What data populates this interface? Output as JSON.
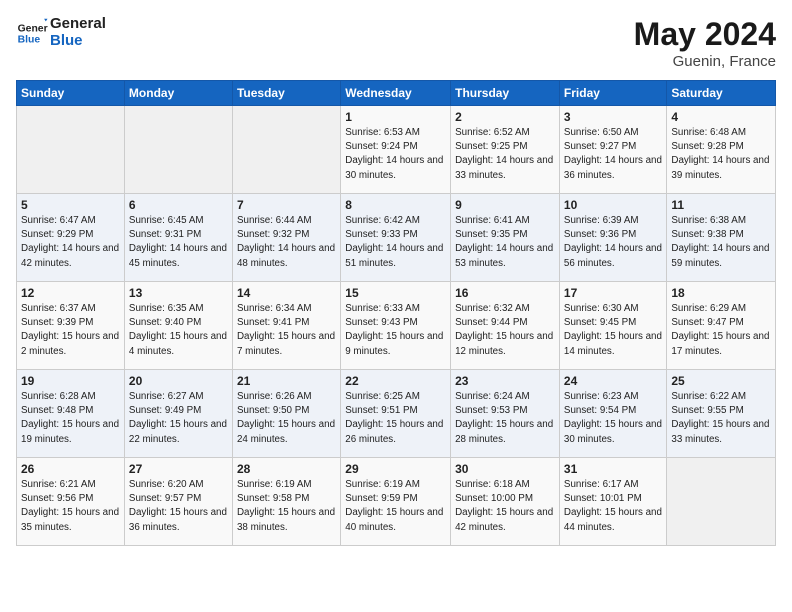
{
  "header": {
    "logo_line1": "General",
    "logo_line2": "Blue",
    "month_year": "May 2024",
    "location": "Guenin, France"
  },
  "days_of_week": [
    "Sunday",
    "Monday",
    "Tuesday",
    "Wednesday",
    "Thursday",
    "Friday",
    "Saturday"
  ],
  "weeks": [
    [
      {
        "day": "",
        "info": ""
      },
      {
        "day": "",
        "info": ""
      },
      {
        "day": "",
        "info": ""
      },
      {
        "day": "1",
        "info": "Sunrise: 6:53 AM\nSunset: 9:24 PM\nDaylight: 14 hours and 30 minutes."
      },
      {
        "day": "2",
        "info": "Sunrise: 6:52 AM\nSunset: 9:25 PM\nDaylight: 14 hours and 33 minutes."
      },
      {
        "day": "3",
        "info": "Sunrise: 6:50 AM\nSunset: 9:27 PM\nDaylight: 14 hours and 36 minutes."
      },
      {
        "day": "4",
        "info": "Sunrise: 6:48 AM\nSunset: 9:28 PM\nDaylight: 14 hours and 39 minutes."
      }
    ],
    [
      {
        "day": "5",
        "info": "Sunrise: 6:47 AM\nSunset: 9:29 PM\nDaylight: 14 hours and 42 minutes."
      },
      {
        "day": "6",
        "info": "Sunrise: 6:45 AM\nSunset: 9:31 PM\nDaylight: 14 hours and 45 minutes."
      },
      {
        "day": "7",
        "info": "Sunrise: 6:44 AM\nSunset: 9:32 PM\nDaylight: 14 hours and 48 minutes."
      },
      {
        "day": "8",
        "info": "Sunrise: 6:42 AM\nSunset: 9:33 PM\nDaylight: 14 hours and 51 minutes."
      },
      {
        "day": "9",
        "info": "Sunrise: 6:41 AM\nSunset: 9:35 PM\nDaylight: 14 hours and 53 minutes."
      },
      {
        "day": "10",
        "info": "Sunrise: 6:39 AM\nSunset: 9:36 PM\nDaylight: 14 hours and 56 minutes."
      },
      {
        "day": "11",
        "info": "Sunrise: 6:38 AM\nSunset: 9:38 PM\nDaylight: 14 hours and 59 minutes."
      }
    ],
    [
      {
        "day": "12",
        "info": "Sunrise: 6:37 AM\nSunset: 9:39 PM\nDaylight: 15 hours and 2 minutes."
      },
      {
        "day": "13",
        "info": "Sunrise: 6:35 AM\nSunset: 9:40 PM\nDaylight: 15 hours and 4 minutes."
      },
      {
        "day": "14",
        "info": "Sunrise: 6:34 AM\nSunset: 9:41 PM\nDaylight: 15 hours and 7 minutes."
      },
      {
        "day": "15",
        "info": "Sunrise: 6:33 AM\nSunset: 9:43 PM\nDaylight: 15 hours and 9 minutes."
      },
      {
        "day": "16",
        "info": "Sunrise: 6:32 AM\nSunset: 9:44 PM\nDaylight: 15 hours and 12 minutes."
      },
      {
        "day": "17",
        "info": "Sunrise: 6:30 AM\nSunset: 9:45 PM\nDaylight: 15 hours and 14 minutes."
      },
      {
        "day": "18",
        "info": "Sunrise: 6:29 AM\nSunset: 9:47 PM\nDaylight: 15 hours and 17 minutes."
      }
    ],
    [
      {
        "day": "19",
        "info": "Sunrise: 6:28 AM\nSunset: 9:48 PM\nDaylight: 15 hours and 19 minutes."
      },
      {
        "day": "20",
        "info": "Sunrise: 6:27 AM\nSunset: 9:49 PM\nDaylight: 15 hours and 22 minutes."
      },
      {
        "day": "21",
        "info": "Sunrise: 6:26 AM\nSunset: 9:50 PM\nDaylight: 15 hours and 24 minutes."
      },
      {
        "day": "22",
        "info": "Sunrise: 6:25 AM\nSunset: 9:51 PM\nDaylight: 15 hours and 26 minutes."
      },
      {
        "day": "23",
        "info": "Sunrise: 6:24 AM\nSunset: 9:53 PM\nDaylight: 15 hours and 28 minutes."
      },
      {
        "day": "24",
        "info": "Sunrise: 6:23 AM\nSunset: 9:54 PM\nDaylight: 15 hours and 30 minutes."
      },
      {
        "day": "25",
        "info": "Sunrise: 6:22 AM\nSunset: 9:55 PM\nDaylight: 15 hours and 33 minutes."
      }
    ],
    [
      {
        "day": "26",
        "info": "Sunrise: 6:21 AM\nSunset: 9:56 PM\nDaylight: 15 hours and 35 minutes."
      },
      {
        "day": "27",
        "info": "Sunrise: 6:20 AM\nSunset: 9:57 PM\nDaylight: 15 hours and 36 minutes."
      },
      {
        "day": "28",
        "info": "Sunrise: 6:19 AM\nSunset: 9:58 PM\nDaylight: 15 hours and 38 minutes."
      },
      {
        "day": "29",
        "info": "Sunrise: 6:19 AM\nSunset: 9:59 PM\nDaylight: 15 hours and 40 minutes."
      },
      {
        "day": "30",
        "info": "Sunrise: 6:18 AM\nSunset: 10:00 PM\nDaylight: 15 hours and 42 minutes."
      },
      {
        "day": "31",
        "info": "Sunrise: 6:17 AM\nSunset: 10:01 PM\nDaylight: 15 hours and 44 minutes."
      },
      {
        "day": "",
        "info": ""
      }
    ]
  ]
}
